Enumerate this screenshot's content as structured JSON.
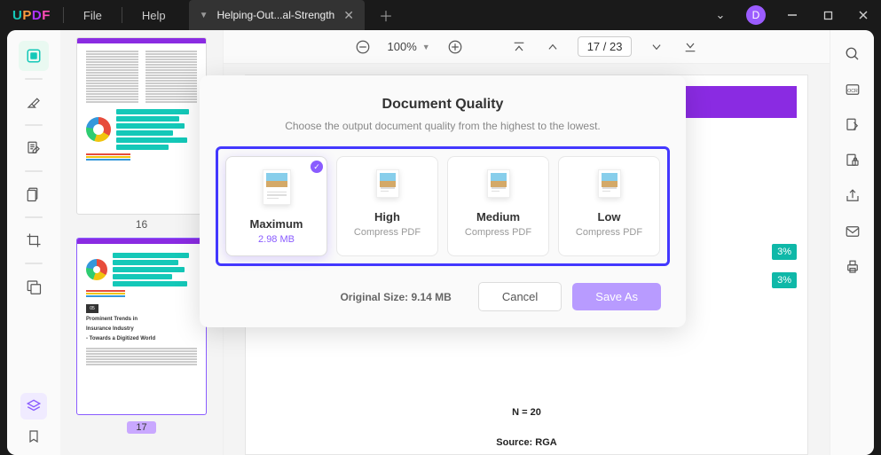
{
  "app": {
    "logo_u": "U",
    "logo_p": "P",
    "logo_d": "D",
    "logo_f": "F"
  },
  "menu": {
    "file": "File",
    "help": "Help"
  },
  "tab": {
    "title": "Helping-Out...al-Strength"
  },
  "avatar": {
    "initial": "D"
  },
  "toolbar": {
    "zoom": "100%",
    "page_current": "17",
    "page_sep": " / ",
    "page_total": "23"
  },
  "thumbs": {
    "page16_num": "16",
    "page17_num": "17",
    "p17_boxnum": "05",
    "p17_line1": "Prominent Trends in",
    "p17_line2": "Insurance Industry",
    "p17_line3": "- Towards a Digitized World"
  },
  "doc": {
    "badge1": "3%",
    "badge2": "3%",
    "n_label": "N = 20",
    "source": "Source: RGA"
  },
  "modal": {
    "title": "Document Quality",
    "subtitle": "Choose the output document quality from the highest to the lowest.",
    "options": {
      "max_name": "Maximum",
      "max_meta": "2.98 MB",
      "high_name": "High",
      "high_meta": "Compress PDF",
      "med_name": "Medium",
      "med_meta": "Compress PDF",
      "low_name": "Low",
      "low_meta": "Compress PDF"
    },
    "original": "Original Size: 9.14 MB",
    "cancel": "Cancel",
    "save": "Save As"
  }
}
